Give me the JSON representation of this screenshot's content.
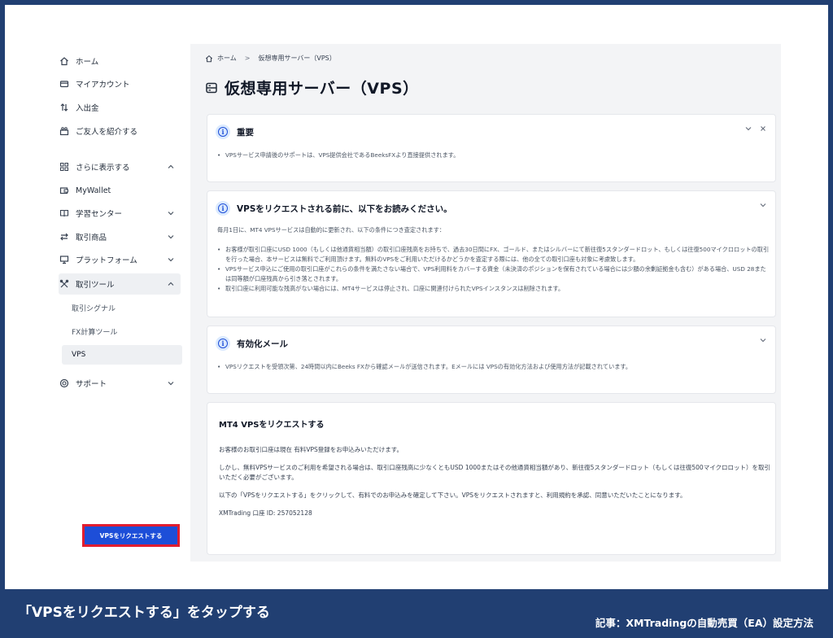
{
  "sidebar": {
    "items": [
      {
        "label": "ホーム",
        "icon": "home-icon"
      },
      {
        "label": "マイアカウント",
        "icon": "card-icon"
      },
      {
        "label": "入出金",
        "icon": "transfer-icon"
      },
      {
        "label": "ご友人を紹介する",
        "icon": "referral-icon"
      },
      {
        "label": "さらに表示する",
        "icon": "grid-icon"
      },
      {
        "label": "MyWallet",
        "icon": "wallet-icon"
      },
      {
        "label": "学習センター",
        "icon": "book-icon"
      },
      {
        "label": "取引商品",
        "icon": "exchange-icon"
      },
      {
        "label": "プラットフォーム",
        "icon": "monitor-icon"
      },
      {
        "label": "取引ツール",
        "icon": "tools-icon"
      },
      {
        "label": "サポート",
        "icon": "lifebuoy-icon"
      }
    ],
    "subitems": [
      "取引シグナル",
      "FX計算ツール",
      "VPS"
    ]
  },
  "breadcrumb": {
    "home": "ホーム",
    "separator": ">",
    "current": "仮想専用サーバー（VPS）"
  },
  "page": {
    "title": "仮想専用サーバー（VPS）"
  },
  "cards": {
    "important": {
      "title": "重要",
      "items": [
        "VPSサービス申請後のサポートは、VPS提供会社であるBeeksFXより直接提供されます。"
      ]
    },
    "before": {
      "title": "VPSをリクエストされる前に、以下をお読みください。",
      "intro": "毎月1日に、MT4 VPSサービスは自動的に更新され、以下の条件につき査定されます：",
      "items": [
        "お客様が取引口座にUSD 1000（もしくは他通貨相当額）の取引口座残高をお持ちで、過去30日間にFX、ゴールド、またはシルバーにて新往復5スタンダードロット、もしくは往復500マイクロロットの取引を行った場合、本サービスは無料でご利用頂けます。無料のVPSをご利用いただけるかどうかを査定する際には、他の全ての取引口座も対象に考慮致します。",
        "VPSサービス申込にご使用の取引口座がこれらの条件を満たさない場合で、VPS利用料をカバーする資金（未決済のポジションを保有されている場合には少額の余剰証拠金も含む）がある場合、USD 28または同等額が口座残高から引き落とされます。",
        "取引口座に利用可能な残高がない場合には、MT4サービスは停止され、口座に関連付けられたVPSインスタンスは削除されます。"
      ]
    },
    "activation": {
      "title": "有効化メール",
      "items": [
        "VPSリクエストを受領次第、24時間以内にBeeks FXから確認メールが送信されます。Eメールには VPSの有効化方法および使用方法が記載されています。"
      ]
    },
    "request": {
      "title": "MT4 VPSをリクエストする",
      "p1": "お客様のお取引口座は現在 有料VPS登録をお申込みいただけます。",
      "p2": "しかし、無料VPSサービスのご利用を希望される場合は、取引口座残高に少なくともUSD 1000またはその他通貨相当額があり、新往復5スタンダードロット（もしくは往復500マイクロロット）を取引いただく必要がございます。",
      "p3": "以下の「VPSをリクエストする」をクリックして、有料でのお申込みを確定して下さい。VPSをリクエストされますと、利用規約を承認、同意いただいたことになります。",
      "account": "XMTrading 口座 ID: 257052128",
      "button": "VPSをリクエストする"
    }
  },
  "banner": {
    "caption": "「VPSをリクエストする」をタップする",
    "article": "記事：XMTradingの自動売買（EA）設定方法"
  },
  "colors": {
    "frame": "#213f72",
    "accent": "#1d4ed8",
    "highlight": "#e11d2f"
  }
}
